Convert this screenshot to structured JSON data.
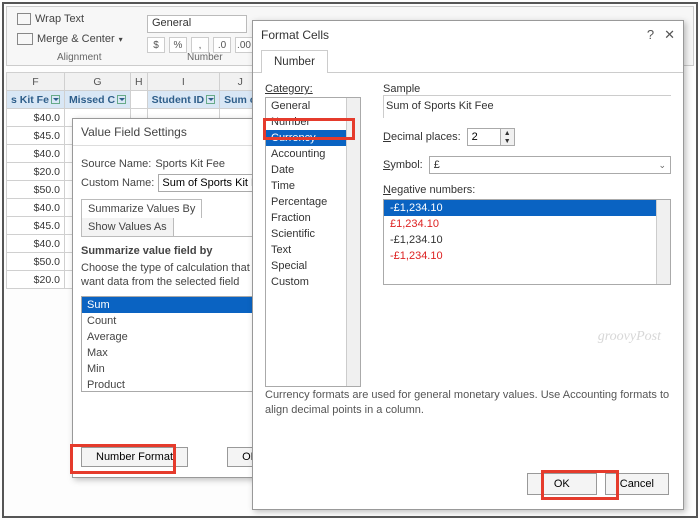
{
  "ribbon": {
    "wrap_text": "Wrap Text",
    "merge_center": "Merge & Center",
    "alignment_group": "Alignment",
    "number_format_selected": "General",
    "number_group": "Number"
  },
  "columns": [
    "F",
    "G",
    "H",
    "I",
    "J"
  ],
  "headers": {
    "f": "s Kit Fe",
    "g": "Missed C",
    "i": "Student ID",
    "j": "Sum o"
  },
  "col_f_values": [
    "$40.0",
    "$45.0",
    "$40.0",
    "$20.0",
    "$50.0",
    "$40.0",
    "$45.0",
    "$40.0",
    "$50.0",
    "$20.0"
  ],
  "vfs": {
    "title": "Value Field Settings",
    "source_label": "Source Name:",
    "source_value": "Sports Kit Fee",
    "custom_label": "Custom Name:",
    "custom_value": "Sum of Sports Kit Fee",
    "tab1": "Summarize Values By",
    "tab2": "Show Values As",
    "summarize_label": "Summarize value field by",
    "summarize_hint": "Choose the type of calculation that you want data from the selected field",
    "calc_options": [
      "Sum",
      "Count",
      "Average",
      "Max",
      "Min",
      "Product"
    ],
    "number_format_btn": "Number Format",
    "ok": "OK"
  },
  "fc": {
    "title": "Format Cells",
    "help": "?",
    "close": "✕",
    "tab_number": "Number",
    "category_label": "Category:",
    "categories": [
      "General",
      "Number",
      "Currency",
      "Accounting",
      "Date",
      "Time",
      "Percentage",
      "Fraction",
      "Scientific",
      "Text",
      "Special",
      "Custom"
    ],
    "selected_category_index": 2,
    "sample_label": "Sample",
    "sample_value": "Sum of Sports Kit Fee",
    "decimal_label": "Decimal places:",
    "decimal_value": "2",
    "symbol_label": "Symbol:",
    "symbol_value": "£",
    "neg_label": "Negative numbers:",
    "neg_options": [
      {
        "text": "-£1,234.10",
        "red": false,
        "sel": true
      },
      {
        "text": "£1,234.10",
        "red": true,
        "sel": false
      },
      {
        "text": "-£1,234.10",
        "red": false,
        "sel": false
      },
      {
        "text": "-£1,234.10",
        "red": true,
        "sel": false
      }
    ],
    "description": "Currency formats are used for general monetary values.  Use Accounting formats to align decimal points in a column.",
    "ok": "OK",
    "cancel": "Cancel"
  },
  "watermark": "groovyPost"
}
